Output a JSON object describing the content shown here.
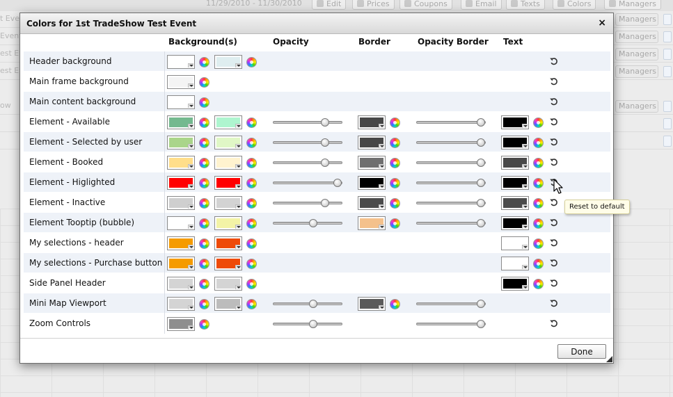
{
  "background_page": {
    "date_range": "11/29/2010 - 11/30/2010",
    "toolbar": [
      "Edit",
      "Prices",
      "Coupons",
      "Email",
      "Texts",
      "Colors",
      "Managers"
    ],
    "row_names": [
      "t Event",
      "Event",
      "est Event",
      "est Event",
      "ow"
    ],
    "managers_label": "Managers"
  },
  "dialog": {
    "title": "Colors for 1st TradeShow Test  Event",
    "close_glyph": "×",
    "headers": {
      "background": "Background(s)",
      "opacity": "Opacity",
      "border": "Border",
      "opacity_border": "Opacity Border",
      "text": "Text"
    },
    "rows": [
      {
        "label": "Header background",
        "bg": [
          "#ffffff",
          "#dfeef0"
        ]
      },
      {
        "label": "Main frame background",
        "bg": [
          "#f4f4f4"
        ]
      },
      {
        "label": "Main content background",
        "bg": [
          "#ffffff"
        ]
      },
      {
        "label": "Element - Available",
        "bg": [
          "#74b98f",
          "#aef5cf"
        ],
        "opacity": 0.75,
        "border": "#474747",
        "opacity_border": 0.93,
        "text": "#000000"
      },
      {
        "label": "Element - Selected by user",
        "bg": [
          "#aad58a",
          "#e0f7c6"
        ],
        "opacity": 0.75,
        "border": "#474747",
        "opacity_border": 0.93,
        "text": "#000000"
      },
      {
        "label": "Element - Booked",
        "bg": [
          "#ffde8a",
          "#fff3cf"
        ],
        "opacity": 0.75,
        "border": "#6f6f6f",
        "opacity_border": 0.93,
        "text": "#484848"
      },
      {
        "label": "Element - Higlighted",
        "bg": [
          "#ff0000",
          "#ff0000"
        ],
        "opacity": 0.93,
        "border": "#000000",
        "opacity_border": 0.93,
        "text": "#000000"
      },
      {
        "label": "Element - Inactive",
        "bg": [
          "#cfcfcf",
          "#d3d3d3"
        ],
        "opacity": 0.75,
        "border": "#4b4b4b",
        "opacity_border": 0.93,
        "text": "#4b4b4b"
      },
      {
        "label": "Element Tooptip (bubble)",
        "bg": [
          "#ffffff",
          "#f3f3a6"
        ],
        "opacity": 0.58,
        "border": "#f4c18c",
        "opacity_border": 0.93,
        "text": "#000000"
      },
      {
        "label": "My selections - header",
        "bg": [
          "#f59b00",
          "#ee4a08"
        ],
        "text": "#ffffff"
      },
      {
        "label": "My selections - Purchase button",
        "bg": [
          "#f59b00",
          "#ee4a08"
        ],
        "text": "#ffffff"
      },
      {
        "label": "Side Panel Header",
        "bg": [
          "#d4d4d4",
          "#d4d4d4"
        ],
        "text": "#000000"
      },
      {
        "label": "Mini Map Viewport",
        "bg": [
          "#d4d4d4",
          "#bcbcbc"
        ],
        "opacity": 0.58,
        "border": "#5a5a5a",
        "opacity_border": 0.93
      },
      {
        "label": "Zoom Controls",
        "bg": [
          "#8e8e8e"
        ],
        "opacity": 0.58,
        "opacity_border": 0.93
      }
    ],
    "done_label": "Done",
    "tooltip": "Reset to default"
  }
}
